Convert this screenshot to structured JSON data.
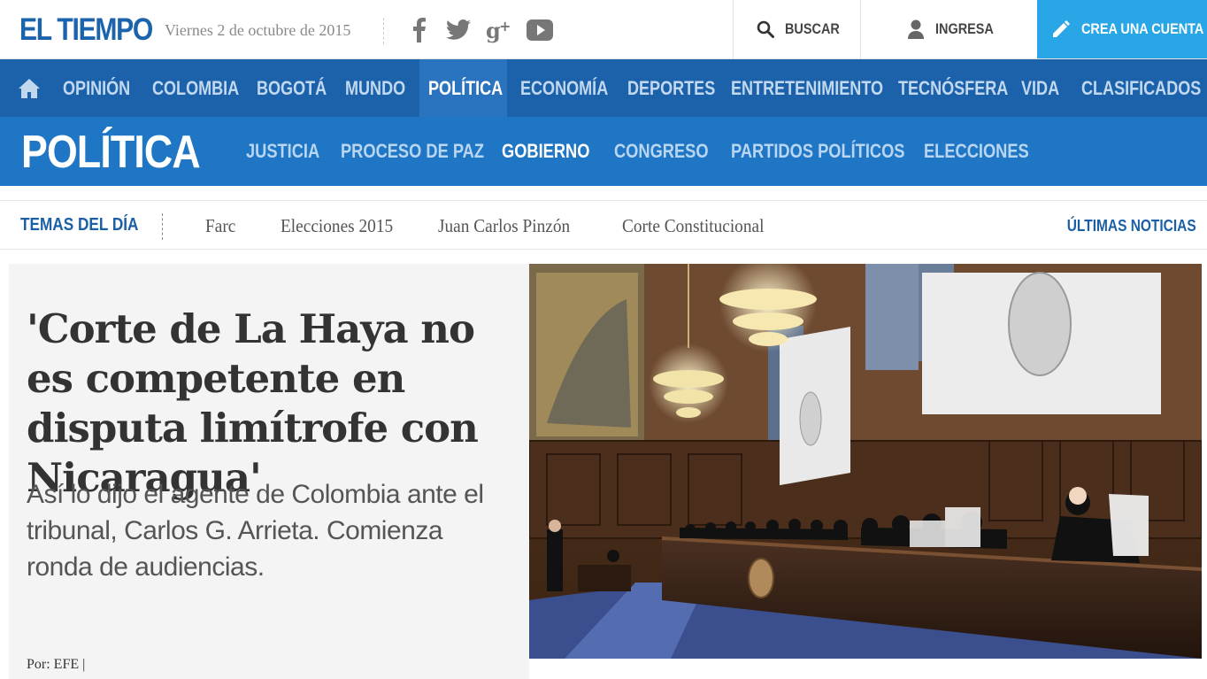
{
  "header": {
    "logo": "EL TIEMPO",
    "date": "Viernes 2 de octubre de 2015",
    "social": [
      {
        "icon": "facebook-icon"
      },
      {
        "icon": "twitter-icon"
      },
      {
        "icon": "googleplus-icon"
      },
      {
        "icon": "youtube-icon"
      }
    ],
    "search_label": "BUSCAR",
    "login_label": "INGRESA",
    "create_label": "CREA UNA CUENTA"
  },
  "main_nav": {
    "items": [
      "OPINIÓN",
      "COLOMBIA",
      "BOGOTÁ",
      "MUNDO",
      "POLÍTICA",
      "ECONOMÍA",
      "DEPORTES",
      "ENTRETENIMIENTO",
      "TECNÓSFERA",
      "VIDA",
      "CLASIFICADOS"
    ],
    "active": "POLÍTICA"
  },
  "section": {
    "title": "POLÍTICA",
    "items": [
      "JUSTICIA",
      "PROCESO DE PAZ",
      "GOBIERNO",
      "CONGRESO",
      "PARTIDOS POLÍTICOS",
      "ELECCIONES"
    ],
    "active": "GOBIERNO"
  },
  "temas": {
    "heading": "TEMAS DEL DÍA",
    "topics": [
      "Farc",
      "Elecciones 2015",
      "Juan Carlos Pinzón",
      "Corte Constitucional"
    ],
    "latest_label": "ÚLTIMAS NOTICIAS"
  },
  "article": {
    "headline": "'Corte de La Haya no es competente en disputa limítrofe con Nicaragua'",
    "summary": "Así lo dijo el agente de Colombia ante el tribunal, Carlos G. Arrieta. Comienza ronda de audiencias.",
    "byline": "Por:  EFE |"
  },
  "colors": {
    "brand_blue": "#1b63ad",
    "main_nav_bg": "#1c62ab",
    "section_bg": "#1f76c4",
    "create_account_bg": "#29a6e6"
  }
}
